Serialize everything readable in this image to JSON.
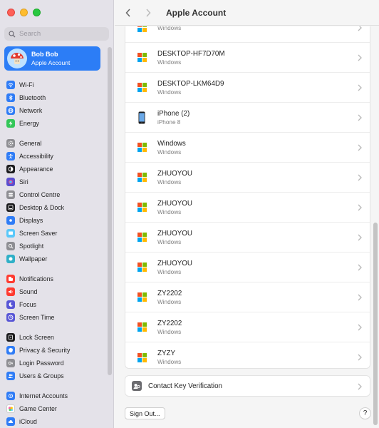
{
  "window": {
    "title": "Apple Account"
  },
  "sidebar": {
    "search_placeholder": "Search",
    "account": {
      "name": "Bob Bob",
      "subtitle": "Apple Account"
    },
    "groups": [
      [
        {
          "label": "Wi-Fi",
          "icon": "wifi-icon",
          "color": "#2f7cf6"
        },
        {
          "label": "Bluetooth",
          "icon": "bluetooth-icon",
          "color": "#2f7cf6"
        },
        {
          "label": "Network",
          "icon": "network-icon",
          "color": "#2f7cf6"
        },
        {
          "label": "Energy",
          "icon": "energy-icon",
          "color": "#34c759"
        }
      ],
      [
        {
          "label": "General",
          "icon": "gear-icon",
          "color": "#8e8e93"
        },
        {
          "label": "Accessibility",
          "icon": "accessibility-icon",
          "color": "#2f7cf6"
        },
        {
          "label": "Appearance",
          "icon": "appearance-icon",
          "color": "#1c1c1e"
        },
        {
          "label": "Siri",
          "icon": "siri-icon",
          "color": "#5a4fcf"
        },
        {
          "label": "Control Centre",
          "icon": "control-centre-icon",
          "color": "#8e8e93"
        },
        {
          "label": "Desktop & Dock",
          "icon": "dock-icon",
          "color": "#1c1c1e"
        },
        {
          "label": "Displays",
          "icon": "displays-icon",
          "color": "#2f7cf6"
        },
        {
          "label": "Screen Saver",
          "icon": "screen-saver-icon",
          "color": "#5ac8fa"
        },
        {
          "label": "Spotlight",
          "icon": "spotlight-icon",
          "color": "#8e8e93"
        },
        {
          "label": "Wallpaper",
          "icon": "wallpaper-icon",
          "color": "#30b0c7"
        }
      ],
      [
        {
          "label": "Notifications",
          "icon": "notifications-icon",
          "color": "#ff3b30"
        },
        {
          "label": "Sound",
          "icon": "sound-icon",
          "color": "#ff3b30"
        },
        {
          "label": "Focus",
          "icon": "focus-icon",
          "color": "#5856d6"
        },
        {
          "label": "Screen Time",
          "icon": "screen-time-icon",
          "color": "#5856d6"
        }
      ],
      [
        {
          "label": "Lock Screen",
          "icon": "lock-screen-icon",
          "color": "#1c1c1e"
        },
        {
          "label": "Privacy & Security",
          "icon": "privacy-icon",
          "color": "#2f7cf6"
        },
        {
          "label": "Login Password",
          "icon": "login-password-icon",
          "color": "#8e8e93"
        },
        {
          "label": "Users & Groups",
          "icon": "users-icon",
          "color": "#2f7cf6"
        }
      ],
      [
        {
          "label": "Internet Accounts",
          "icon": "internet-accounts-icon",
          "color": "#2f7cf6"
        },
        {
          "label": "Game Center",
          "icon": "game-center-icon",
          "color": "#ffffff"
        },
        {
          "label": "iCloud",
          "icon": "icloud-icon",
          "color": "#2f7cf6"
        }
      ]
    ]
  },
  "devices": [
    {
      "name": "",
      "type": "Windows",
      "icon": "windows-icon"
    },
    {
      "name": "DESKTOP-HF7D70M",
      "type": "Windows",
      "icon": "windows-icon"
    },
    {
      "name": "DESKTOP-LKM64D9",
      "type": "Windows",
      "icon": "windows-icon"
    },
    {
      "name": "iPhone (2)",
      "type": "iPhone 8",
      "icon": "iphone-icon"
    },
    {
      "name": "Windows",
      "type": "Windows",
      "icon": "windows-icon"
    },
    {
      "name": "ZHUOYOU",
      "type": "Windows",
      "icon": "windows-icon"
    },
    {
      "name": "ZHUOYOU",
      "type": "Windows",
      "icon": "windows-icon"
    },
    {
      "name": "ZHUOYOU",
      "type": "Windows",
      "icon": "windows-icon"
    },
    {
      "name": "ZHUOYOU",
      "type": "Windows",
      "icon": "windows-icon"
    },
    {
      "name": "ZY2202",
      "type": "Windows",
      "icon": "windows-icon"
    },
    {
      "name": "ZY2202",
      "type": "Windows",
      "icon": "windows-icon"
    },
    {
      "name": "ZYZY",
      "type": "Windows",
      "icon": "windows-icon"
    }
  ],
  "contact_key": {
    "label": "Contact Key Verification"
  },
  "footer": {
    "sign_out": "Sign Out...",
    "help": "?"
  }
}
